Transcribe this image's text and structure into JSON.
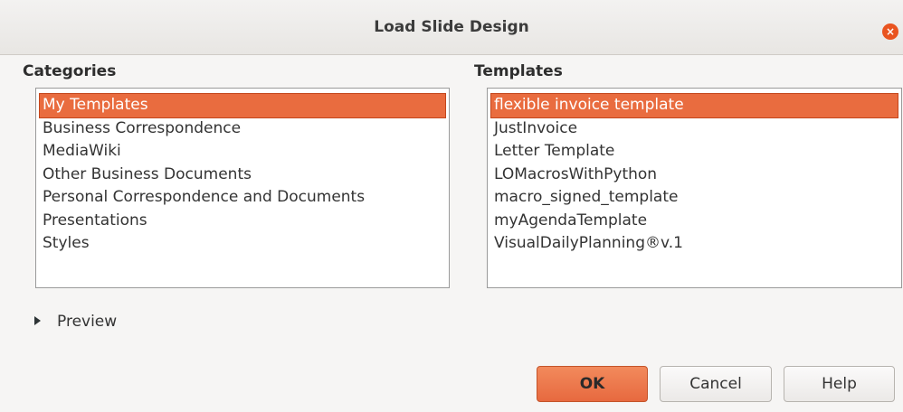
{
  "window": {
    "title": "Load Slide Design",
    "close_glyph": "×"
  },
  "categories": {
    "label": "Categories",
    "items": [
      {
        "label": "My Templates",
        "selected": true
      },
      {
        "label": "Business Correspondence",
        "selected": false
      },
      {
        "label": "MediaWiki",
        "selected": false
      },
      {
        "label": "Other Business Documents",
        "selected": false
      },
      {
        "label": "Personal Correspondence and Documents",
        "selected": false
      },
      {
        "label": "Presentations",
        "selected": false
      },
      {
        "label": "Styles",
        "selected": false
      }
    ]
  },
  "templates": {
    "label": "Templates",
    "items": [
      {
        "label": "flexible invoice template",
        "selected": true
      },
      {
        "label": "JustInvoice",
        "selected": false
      },
      {
        "label": "Letter Template",
        "selected": false
      },
      {
        "label": "LOMacrosWithPython",
        "selected": false
      },
      {
        "label": "macro_signed_template",
        "selected": false
      },
      {
        "label": "myAgendaTemplate",
        "selected": false
      },
      {
        "label": "VisualDailyPlanning®v.1",
        "selected": false
      }
    ]
  },
  "preview": {
    "label": "Preview"
  },
  "buttons": {
    "ok": "OK",
    "cancel": "Cancel",
    "help": "Help"
  },
  "colors": {
    "accent": "#e96c3f",
    "close": "#e95420"
  }
}
